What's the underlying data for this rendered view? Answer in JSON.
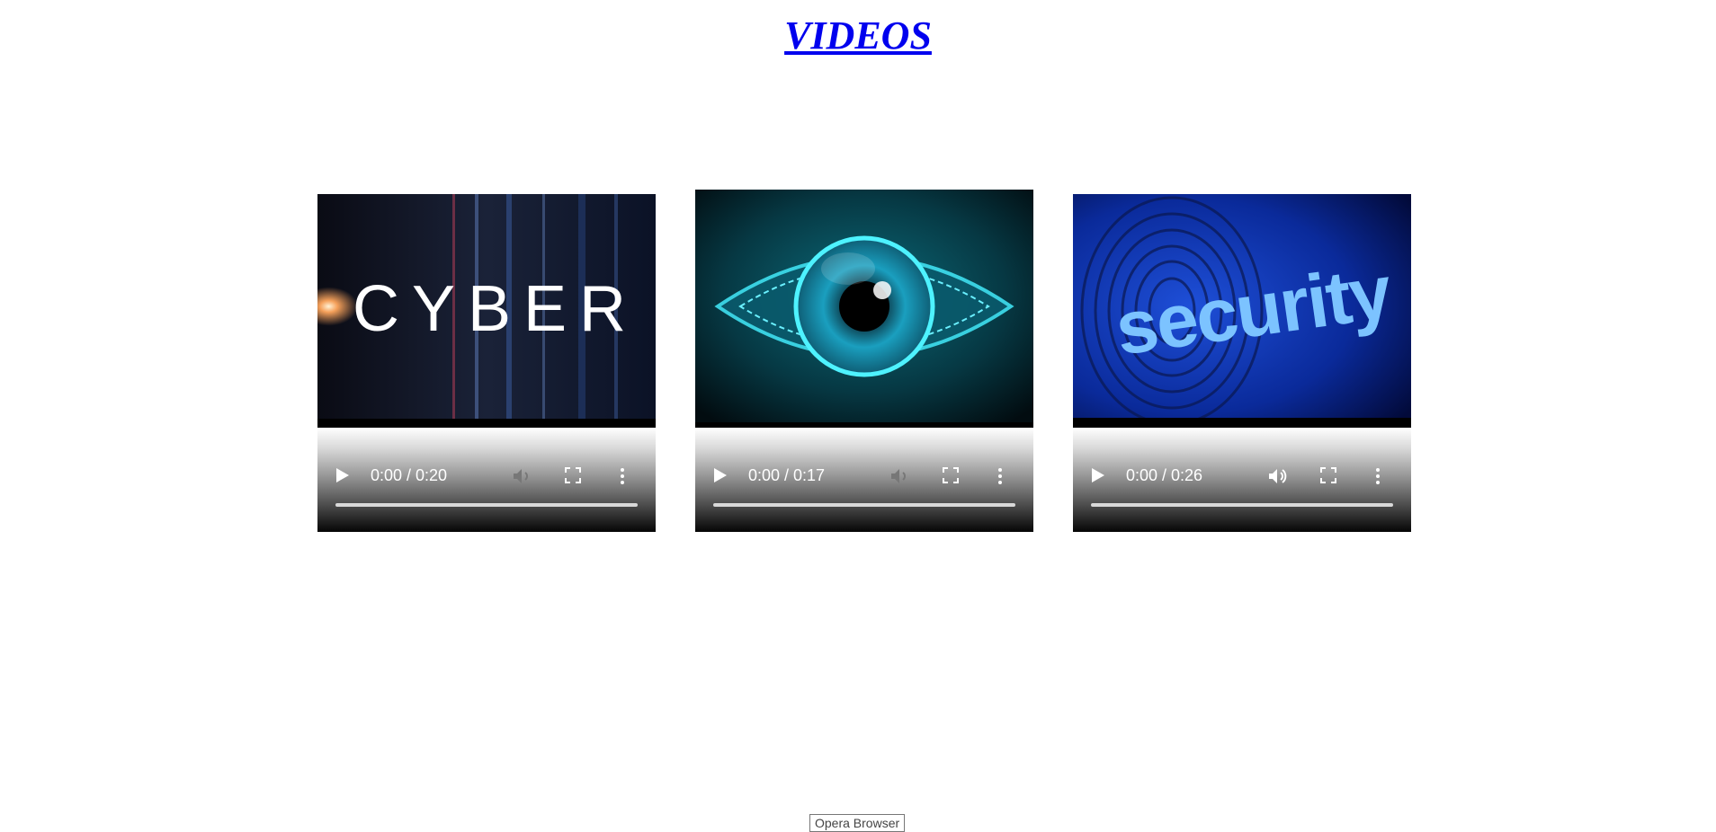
{
  "header": {
    "title": "VIDEOS"
  },
  "videos": [
    {
      "thumbnail_text": "CYBER",
      "time": "0:00 / 0:20",
      "volume_enabled": false
    },
    {
      "thumbnail_text": "",
      "time": "0:00 / 0:17",
      "volume_enabled": false
    },
    {
      "thumbnail_text": "security",
      "time": "0:00 / 0:26",
      "volume_enabled": true
    }
  ],
  "icons": {
    "play": "play-icon",
    "volume": "volume-icon",
    "fullscreen": "fullscreen-icon",
    "more": "more-options-icon"
  },
  "footer": {
    "label": "Opera Browser"
  }
}
